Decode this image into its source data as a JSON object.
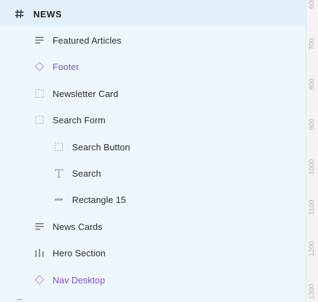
{
  "layers": {
    "frame": {
      "label": "NEWS",
      "icon": "hash-icon"
    },
    "items": [
      {
        "label": "Featured Articles",
        "icon": "text-lines-icon",
        "kind": "group"
      },
      {
        "label": "Footer",
        "icon": "component-instance-icon",
        "kind": "component"
      },
      {
        "label": "Newsletter Card",
        "icon": "dashed-frame-icon",
        "kind": "frame"
      },
      {
        "label": "Search Form",
        "icon": "dashed-frame-icon",
        "kind": "frame"
      },
      {
        "label": "Search Button",
        "icon": "dashed-frame-icon",
        "kind": "frame"
      },
      {
        "label": "Search",
        "icon": "text-t-icon",
        "kind": "text"
      },
      {
        "label": "Rectangle 15",
        "icon": "rectangle-icon",
        "kind": "shape"
      },
      {
        "label": "News Cards",
        "icon": "text-lines-icon",
        "kind": "group"
      },
      {
        "label": "Hero Section",
        "icon": "vertical-bars-icon",
        "kind": "group"
      },
      {
        "label": "Nav Desktop",
        "icon": "component-instance-icon",
        "kind": "component"
      }
    ]
  },
  "ruler": {
    "ticks": [
      "600",
      "700",
      "800",
      "900",
      "1000",
      "1100",
      "1200",
      "1300"
    ]
  },
  "colors": {
    "component_text": "#7a4cd1",
    "panel_bg": "#eff7fe",
    "header_bg": "#e3f1fd"
  }
}
